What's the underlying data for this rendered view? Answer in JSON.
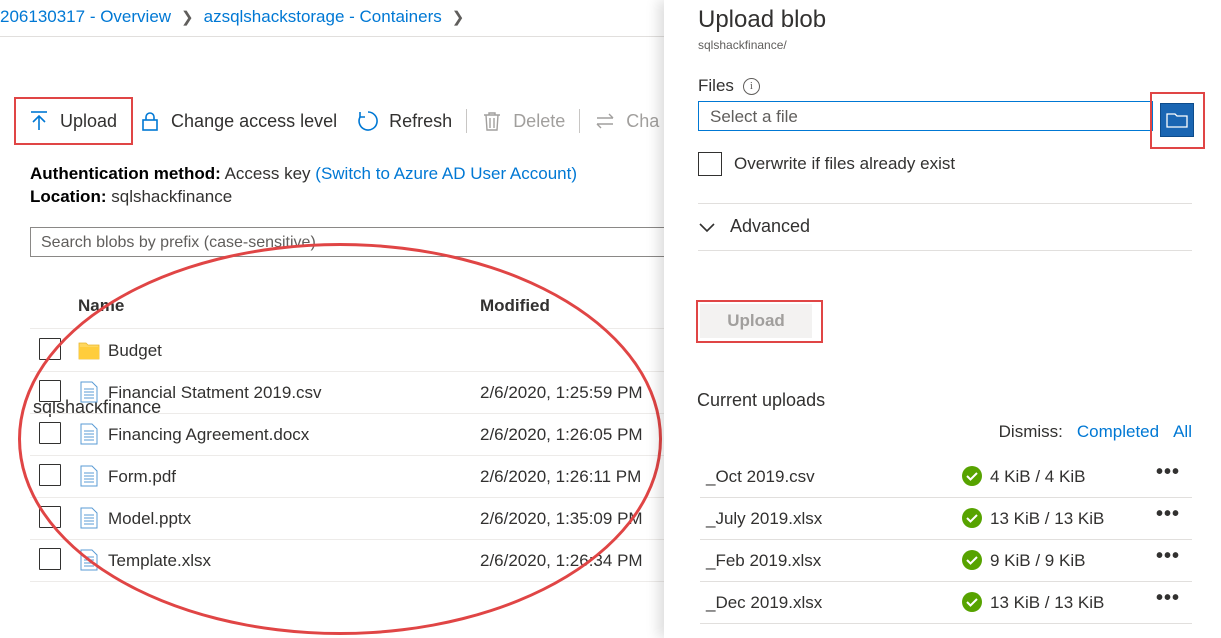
{
  "breadcrumb": {
    "items": [
      "206130317 - Overview",
      "azsqlshackstorage - Containers"
    ],
    "current": "sqlshackfinance"
  },
  "toolbar": {
    "upload": "Upload",
    "change_access": "Change access level",
    "refresh": "Refresh",
    "delete": "Delete",
    "change_tier": "Cha"
  },
  "auth": {
    "method_label": "Authentication method:",
    "method_value": "Access key",
    "switch_link": "(Switch to Azure AD User Account)",
    "location_label": "Location:",
    "location_value": "sqlshackfinance"
  },
  "search": {
    "placeholder": "Search blobs by prefix (case-sensitive)"
  },
  "table": {
    "headers": {
      "name": "Name",
      "modified": "Modified"
    },
    "rows": [
      {
        "name": "Budget",
        "modified": "",
        "icon": "folder-icon"
      },
      {
        "name": "Financial Statment 2019.csv",
        "modified": "2/6/2020, 1:25:59 PM",
        "icon": "file-icon"
      },
      {
        "name": "Financing Agreement.docx",
        "modified": "2/6/2020, 1:26:05 PM",
        "icon": "file-icon"
      },
      {
        "name": "Form.pdf",
        "modified": "2/6/2020, 1:26:11 PM",
        "icon": "file-icon"
      },
      {
        "name": "Model.pptx",
        "modified": "2/6/2020, 1:35:09 PM",
        "icon": "file-icon"
      },
      {
        "name": "Template.xlsx",
        "modified": "2/6/2020, 1:26:34 PM",
        "icon": "file-icon"
      }
    ]
  },
  "panel": {
    "title": "Upload blob",
    "subtitle": "sqlshackfinance/",
    "files_label": "Files",
    "file_placeholder": "Select a file",
    "overwrite_label": "Overwrite if files already exist",
    "advanced_label": "Advanced",
    "upload_button": "Upload",
    "current_uploads": "Current uploads",
    "dismiss_label": "Dismiss:",
    "dismiss_completed": "Completed",
    "dismiss_all": "All",
    "uploads": [
      {
        "file": "_Oct 2019.csv",
        "size": "4 KiB / 4 KiB"
      },
      {
        "file": "_July 2019.xlsx",
        "size": "13 KiB / 13 KiB"
      },
      {
        "file": "_Feb 2019.xlsx",
        "size": "9 KiB / 9 KiB"
      },
      {
        "file": "_Dec 2019.xlsx",
        "size": "13 KiB / 13 KiB"
      }
    ],
    "more_glyph": "•••"
  },
  "colors": {
    "accent": "#0078d4",
    "highlight": "#e04545",
    "success": "#57a300"
  }
}
